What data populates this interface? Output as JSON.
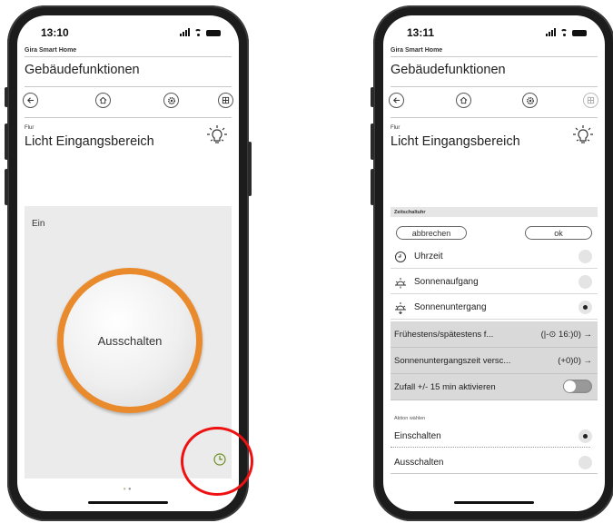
{
  "left_screen": {
    "status_time": "13:10",
    "brand": "Gira Smart Home",
    "page_title": "Gebäudefunktionen",
    "nav": {
      "back_icon": "back-arrow-icon",
      "home_icon": "home-icon",
      "settings_icon": "gear-icon",
      "grid_icon": "grid-icon"
    },
    "room": "Flur",
    "device": "Licht Eingangsbereich",
    "state_label": "Ein",
    "main_button": "Ausschalten",
    "accent_color": "#e98a2d",
    "highlight_color": "#e11111"
  },
  "right_screen": {
    "status_time": "13:11",
    "brand": "Gira Smart Home",
    "page_title": "Gebäudefunktionen",
    "room": "Flur",
    "device": "Licht Eingangsbereich",
    "timer_section": "Zeitschaltuhr",
    "cancel_label": "abbrechen",
    "ok_label": "ok",
    "options": [
      {
        "label": "Uhrzeit",
        "icon": "clock-icon",
        "selected": false
      },
      {
        "label": "Sonnenaufgang",
        "icon": "sunrise-icon",
        "selected": false
      },
      {
        "label": "Sonnenuntergang",
        "icon": "sunset-icon",
        "selected": true
      }
    ],
    "settings": [
      {
        "label": "Frühestens/spätestens f...",
        "value": "(|-⊙ 16:)0) →"
      },
      {
        "label": "Sonnenuntergangszeit versc...",
        "value": "(+0)0) →"
      }
    ],
    "random_label": "Zufall +/- 15 min aktivieren",
    "random_enabled": false,
    "action_section": "Aktion wählen",
    "actions": [
      {
        "label": "Einschalten",
        "selected": true
      },
      {
        "label": "Ausschalten",
        "selected": false
      }
    ]
  }
}
